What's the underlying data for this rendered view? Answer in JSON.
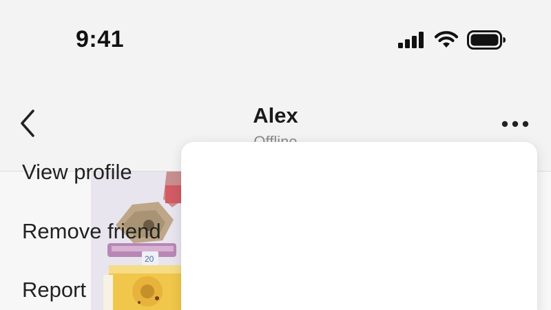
{
  "status_bar": {
    "time": "9:41",
    "icons": [
      "cellular-signal-icon",
      "wifi-icon",
      "battery-icon"
    ]
  },
  "header": {
    "back_icon": "chevron-left-icon",
    "contact_name": "Alex",
    "status_text": "Offline",
    "more_icon": "more-horizontal-icon"
  },
  "conversation": {
    "shared_image": "photo of a colorful capsule toy tower"
  },
  "menu": {
    "items": [
      {
        "label": "View profile"
      },
      {
        "label": "Remove friend"
      },
      {
        "label": "Report"
      }
    ]
  },
  "colors": {
    "background": "#f3f3f3",
    "menu_background": "#ffffff",
    "text_primary": "#1a1a1a",
    "text_secondary": "#8a8a8a"
  }
}
